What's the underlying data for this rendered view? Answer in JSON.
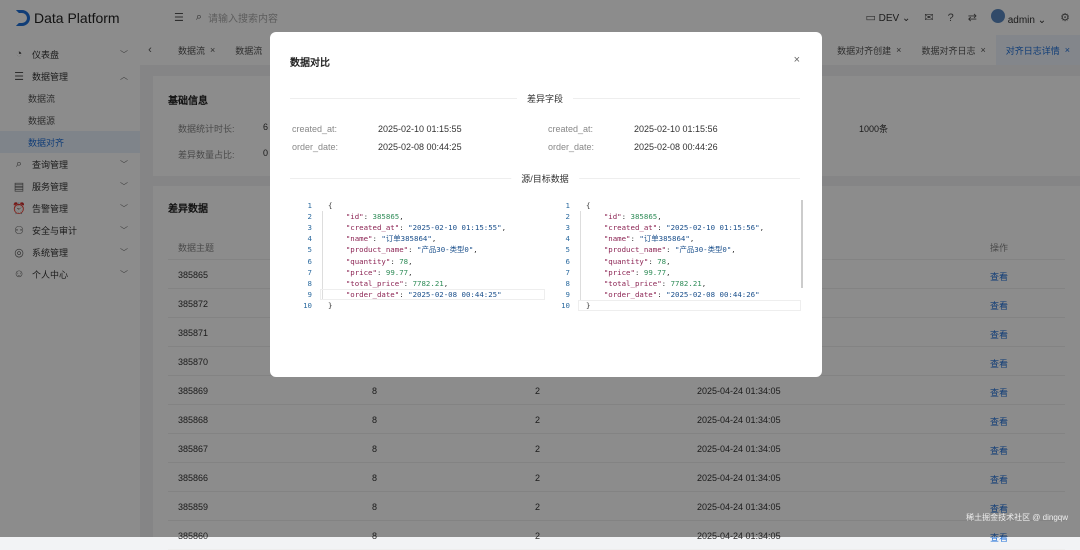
{
  "app": {
    "title": "Data Platform",
    "search_placeholder": "请输入搜索内容",
    "env": "DEV",
    "user": "admin"
  },
  "sidebar": {
    "items": [
      {
        "label": "仪表盘",
        "icon": "dashboard-icon"
      },
      {
        "label": "数据管理",
        "icon": "database-icon",
        "expanded": true,
        "children": [
          "数据流",
          "数据源",
          "数据对齐"
        ]
      },
      {
        "label": "查询管理",
        "icon": "query-icon"
      },
      {
        "label": "服务管理",
        "icon": "service-icon"
      },
      {
        "label": "告警管理",
        "icon": "alarm-icon"
      },
      {
        "label": "安全与审计",
        "icon": "user-shield-icon"
      },
      {
        "label": "系统管理",
        "icon": "settings-icon"
      },
      {
        "label": "个人中心",
        "icon": "profile-icon"
      }
    ],
    "active_child": "数据对齐"
  },
  "tabs": [
    "数据流",
    "数据流",
    "数据对齐创建",
    "数据对齐日志",
    "对齐日志详情"
  ],
  "basic_info": {
    "title": "基础信息",
    "fields": [
      {
        "label": "数据统计时长:",
        "value": "6"
      },
      {
        "label": "差异数量占比:",
        "value": "0"
      }
    ],
    "count": "1000条"
  },
  "diff_data": {
    "title": "差异数据",
    "headers": {
      "topic": "数据主题",
      "op": "操作"
    },
    "rows": [
      {
        "id": "385865",
        "a": "",
        "b": "",
        "t": "",
        "op": "查看"
      },
      {
        "id": "385872",
        "a": "",
        "b": "",
        "t": "",
        "op": "查看"
      },
      {
        "id": "385871",
        "a": "",
        "b": "",
        "t": "",
        "op": "查看"
      },
      {
        "id": "385870",
        "a": "",
        "b": "",
        "t": "",
        "op": "查看"
      },
      {
        "id": "385869",
        "a": "8",
        "b": "2",
        "t": "2025-04-24 01:34:05",
        "op": "查看"
      },
      {
        "id": "385868",
        "a": "8",
        "b": "2",
        "t": "2025-04-24 01:34:05",
        "op": "查看"
      },
      {
        "id": "385867",
        "a": "8",
        "b": "2",
        "t": "2025-04-24 01:34:05",
        "op": "查看"
      },
      {
        "id": "385866",
        "a": "8",
        "b": "2",
        "t": "2025-04-24 01:34:05",
        "op": "查看"
      },
      {
        "id": "385859",
        "a": "8",
        "b": "2",
        "t": "2025-04-24 01:34:05",
        "op": "查看"
      },
      {
        "id": "385860",
        "a": "8",
        "b": "2",
        "t": "2025-04-24 01:34:05",
        "op": "查看"
      }
    ]
  },
  "modal": {
    "title": "数据对比",
    "close": "×",
    "diff_section": "差异字段",
    "data_section": "源/目标数据",
    "source_fields": [
      {
        "label": "created_at:",
        "value": "2025-02-10 01:15:55"
      },
      {
        "label": "order_date:",
        "value": "2025-02-08 00:44:25"
      }
    ],
    "target_fields": [
      {
        "label": "created_at:",
        "value": "2025-02-10 01:15:56"
      },
      {
        "label": "order_date:",
        "value": "2025-02-08 00:44:26"
      }
    ],
    "source_json": [
      "{",
      "    \"id\": 385865,",
      "    \"created_at\": \"2025-02-10 01:15:55\",",
      "    \"name\": \"订单385864\",",
      "    \"product_name\": \"产品30-类型0\",",
      "    \"quantity\": 78,",
      "    \"price\": 99.77,",
      "    \"total_price\": 7782.21,",
      "    \"order_date\": \"2025-02-08 00:44:25\"",
      "}"
    ],
    "target_json": [
      "{",
      "    \"id\": 385865,",
      "    \"created_at\": \"2025-02-10 01:15:56\",",
      "    \"name\": \"订单385864\",",
      "    \"product_name\": \"产品30-类型0\",",
      "    \"quantity\": 78,",
      "    \"price\": 99.77,",
      "    \"total_price\": 7782.21,",
      "    \"order_date\": \"2025-02-08 00:44:26\"",
      "}"
    ]
  },
  "watermark": "稀土掘金技术社区 @ dingqw"
}
